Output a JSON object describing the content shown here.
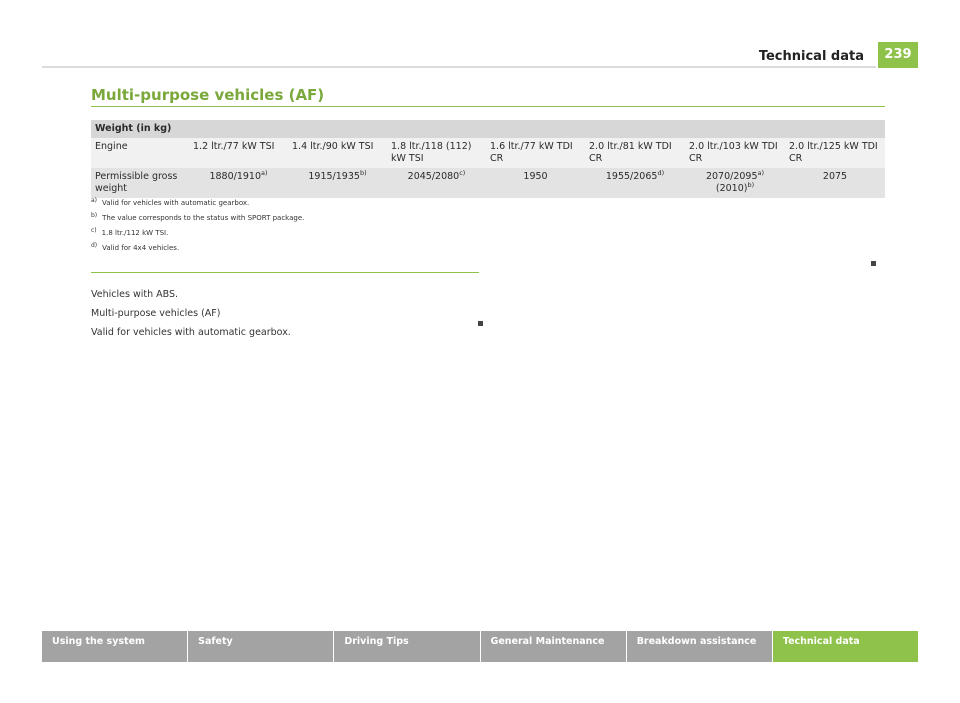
{
  "header": {
    "title": "Technical data",
    "page_number": "239"
  },
  "section": {
    "title": "Multi-purpose vehicles (AF)"
  },
  "table": {
    "heading": "Weight (in kg)",
    "row_engine_label": "Engine",
    "engines": [
      "1.2 ltr./77 kW TSI",
      "1.4 ltr./90 kW TSI",
      "1.8 ltr./118 (112) kW TSI",
      "1.6 ltr./77 kW TDI CR",
      "2.0 ltr./81 kW TDI CR",
      "2.0 ltr./103 kW TDI CR",
      "2.0 ltr./125 kW TDI CR"
    ],
    "row_weight_label": "Permissible gross weight",
    "weights": [
      {
        "value": "1880/1910",
        "note": "a)"
      },
      {
        "value": "1915/1935",
        "note": "b)"
      },
      {
        "value": "2045/2080",
        "note": "c)"
      },
      {
        "value": "1950",
        "note": ""
      },
      {
        "value": "1955/2065",
        "note": "d)"
      },
      {
        "value": "2070/2095",
        "note": "a)",
        "value2": "(2010)",
        "note2": "b)"
      },
      {
        "value": "2075",
        "note": ""
      }
    ]
  },
  "footnotes": [
    {
      "mark": "a)",
      "text": "Valid for vehicles with automatic gearbox."
    },
    {
      "mark": "b)",
      "text": "The value corresponds to the status with SPORT package."
    },
    {
      "mark": "c)",
      "text": "1.8 ltr./112 kW TSI."
    },
    {
      "mark": "d)",
      "text": "Valid for 4x4 vehicles."
    }
  ],
  "body_lines": [
    "Vehicles with ABS.",
    "Multi-purpose vehicles (AF)",
    "Valid for vehicles with automatic gearbox."
  ],
  "nav_tabs": [
    {
      "label": "Using the system",
      "active": false
    },
    {
      "label": "Safety",
      "active": false
    },
    {
      "label": "Driving Tips",
      "active": false
    },
    {
      "label": "General Maintenance",
      "active": false
    },
    {
      "label": "Breakdown assistance",
      "active": false
    },
    {
      "label": "Technical data",
      "active": true
    }
  ],
  "colors": {
    "accent": "#8fc24a",
    "title": "#7aa83a",
    "nav": "#a3a3a3"
  }
}
